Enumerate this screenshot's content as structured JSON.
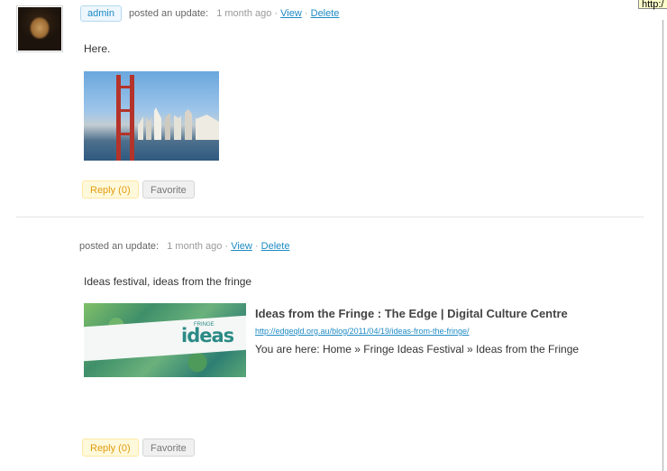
{
  "tooltip": {
    "text": "http:/"
  },
  "post1": {
    "user": "admin",
    "action": "posted an update:",
    "time": "1 month ago",
    "view_label": "View",
    "delete_label": "Delete",
    "separator": "·",
    "text": "Here.",
    "reply_label": "Reply (0)",
    "favorite_label": "Favorite"
  },
  "post2": {
    "action": "posted an update:",
    "time": "1 month ago",
    "view_label": "View",
    "delete_label": "Delete",
    "separator": "·",
    "text": "Ideas festival, ideas from the fringe",
    "link": {
      "title": "Ideas from the Fringe : The Edge | Digital Culture Centre",
      "url": "http://edgeqld.org.au/blog/2011/04/19/ideas-from-the-fringe/",
      "description": "You are here: Home » Fringe Ideas Festival » Ideas from the Fringe",
      "thumb_logo": "ideas",
      "thumb_small": "FRINGE"
    },
    "reply_label": "Reply (0)",
    "favorite_label": "Favorite"
  },
  "colors": {
    "link": "#1e8ac4",
    "reply_bg": "#fff9db",
    "reply_text": "#e19b0f",
    "favorite_bg": "#f0f0f0"
  }
}
